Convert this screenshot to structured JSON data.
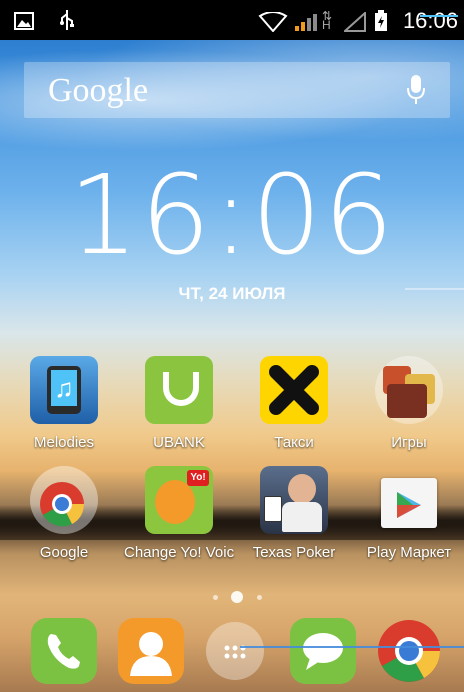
{
  "statusbar": {
    "time": "16:06",
    "icons": [
      "picture-icon",
      "usb-icon",
      "wifi-icon",
      "signal-icon",
      "network-h-icon",
      "signal-empty-icon",
      "battery-icon"
    ],
    "network_label": "H"
  },
  "search": {
    "logo": "Google",
    "mic_icon": "microphone-icon"
  },
  "clock": {
    "time": "16:06",
    "date": "ЧТ, 24 ИЮЛЯ"
  },
  "apps_row1": [
    {
      "label": "Melodies",
      "icon": "melodies-icon"
    },
    {
      "label": "UBANK",
      "icon": "ubank-icon"
    },
    {
      "label": "Такси",
      "icon": "taxi-icon"
    },
    {
      "label": "Игры",
      "icon": "games-folder-icon"
    }
  ],
  "apps_row2": [
    {
      "label": "Google",
      "icon": "google-folder-icon"
    },
    {
      "label": "Change Yo! Voic",
      "icon": "change-yo-voice-icon"
    },
    {
      "label": "Texas Poker",
      "icon": "texas-poker-icon"
    },
    {
      "label": "Play Маркет",
      "icon": "play-market-icon"
    }
  ],
  "dock": [
    {
      "icon": "phone-icon"
    },
    {
      "icon": "contacts-icon"
    },
    {
      "icon": "app-drawer-icon"
    },
    {
      "icon": "messaging-icon"
    },
    {
      "icon": "chrome-icon"
    }
  ],
  "pages": {
    "count": 3,
    "current": 2
  },
  "colors": {
    "statusbar": "#000000",
    "phone_green": "#7cc242",
    "contacts_orange": "#f39a2a",
    "chrome_red": "#d93c2c"
  }
}
